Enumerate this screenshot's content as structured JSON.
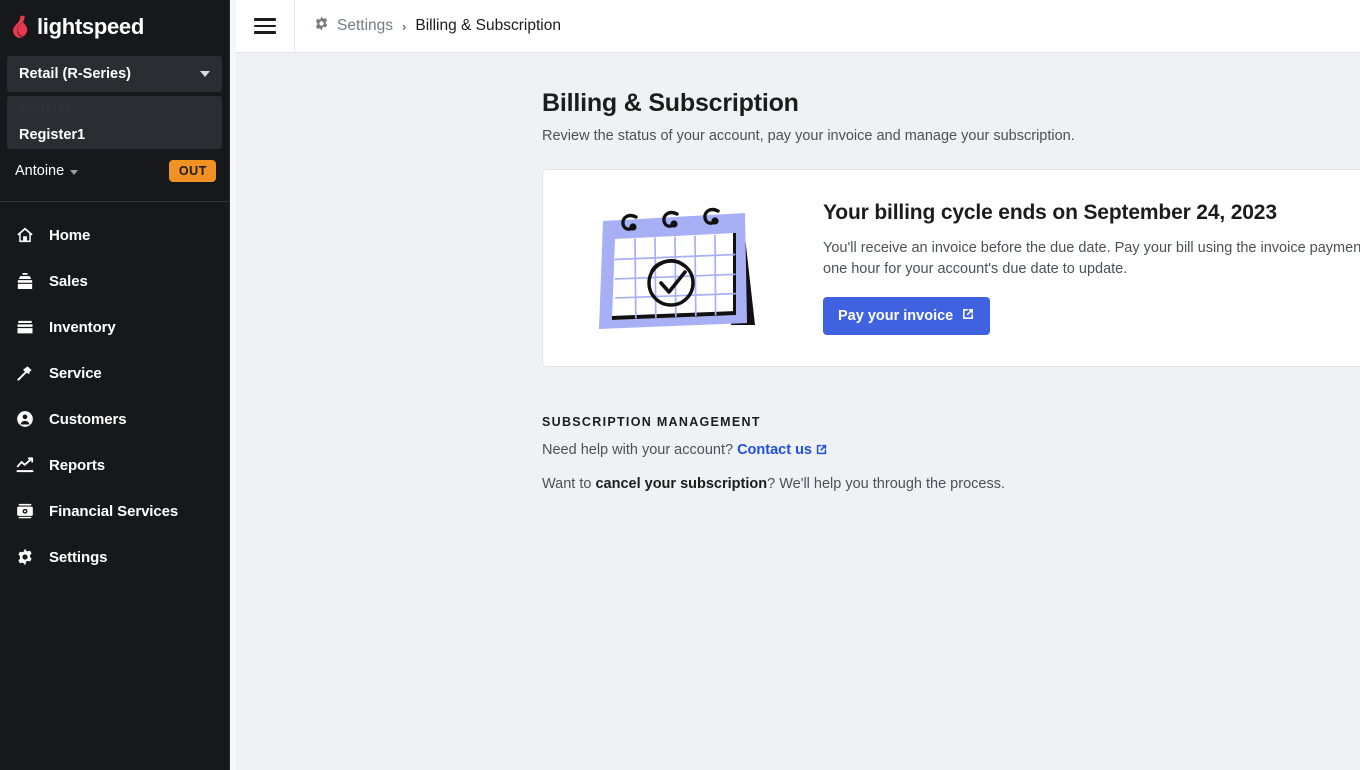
{
  "brand": {
    "name": "lightspeed",
    "logo_color": "#e8384f",
    "accent_blue": "#3f63e0",
    "link_blue": "#1f4fe0",
    "badge_orange": "#ef9123",
    "sidebar_bg": "#17181c",
    "page_bg": "#eef2f5"
  },
  "sidebar": {
    "shop_selector": {
      "label": "Retail (R-Series)",
      "icon": "chevron-down-icon"
    },
    "register": {
      "ghost_label": "REGISTER",
      "name": "Register1"
    },
    "user": {
      "name": "Antoine",
      "status_badge": "OUT",
      "icon": "chevron-down-icon"
    },
    "nav_items": [
      {
        "label": "Home",
        "icon": "home-icon"
      },
      {
        "label": "Sales",
        "icon": "cash-register-icon"
      },
      {
        "label": "Inventory",
        "icon": "inventory-box-icon"
      },
      {
        "label": "Service",
        "icon": "hammer-icon"
      },
      {
        "label": "Customers",
        "icon": "person-circle-icon"
      },
      {
        "label": "Reports",
        "icon": "line-chart-icon"
      },
      {
        "label": "Financial Services",
        "icon": "banknote-icon"
      },
      {
        "label": "Settings",
        "icon": "gear-icon"
      }
    ]
  },
  "topbar": {
    "menu_icon": "hamburger-icon",
    "breadcrumb": {
      "icon": "gear-icon",
      "parent": "Settings",
      "separator": "›",
      "current": "Billing & Subscription"
    }
  },
  "main": {
    "title": "Billing & Subscription",
    "subtitle": "Review the status of your account, pay your invoice and manage your subscription.",
    "billing_card": {
      "illustration": "desk-calendar-check-illustration",
      "heading": "Your billing cycle ends on September 24, 2023",
      "body": "You'll receive an invoice before the due date. Pay your bill using the invoice payment form. Once paid, it can take up-to one hour for your account's due date to update.",
      "button_label": "Pay your invoice",
      "button_icon": "external-link-icon"
    },
    "subscription_management": {
      "section_title": "SUBSCRIPTION MANAGEMENT",
      "help_prefix": "Need help with your account?",
      "help_link": "Contact us",
      "help_link_icon": "external-link-icon",
      "cancel_prefix": "Want to ",
      "cancel_link": "cancel your subscription",
      "cancel_suffix": "? We'll help you through the process."
    }
  }
}
